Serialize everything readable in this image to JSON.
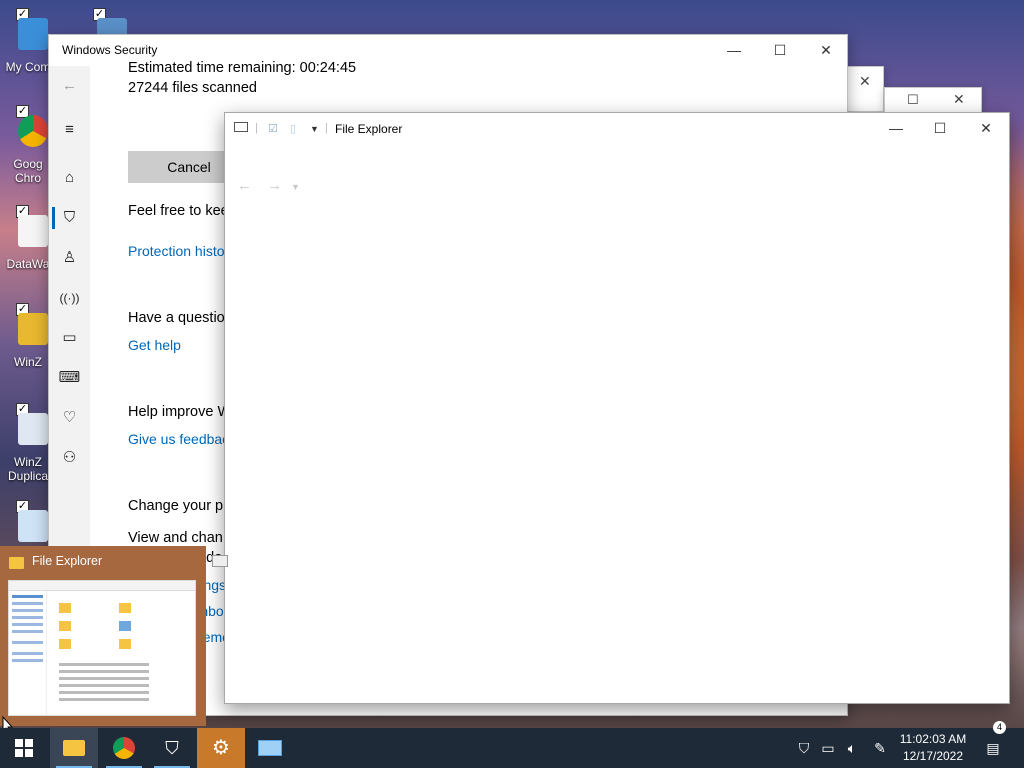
{
  "desktop": {
    "icons": [
      {
        "label": "My Com",
        "icon": "computer-icon"
      },
      {
        "label": "Goog Chro",
        "icon": "chrome-icon"
      },
      {
        "label": "DataWa",
        "icon": "document-icon"
      },
      {
        "label": "WinZ",
        "icon": "winzip-icon"
      },
      {
        "label": "WinZ Duplica",
        "icon": "winzip-duplicate-icon"
      }
    ]
  },
  "windows_security": {
    "title": "Windows Security",
    "estimated_time": "Estimated time remaining: 00:24:45",
    "files_scanned": "27244  files scanned",
    "cancel_label": "Cancel",
    "feel_free": "Feel free to kee",
    "protection_history": "Protection histo",
    "question_heading": "Have a questio",
    "get_help": "Get help",
    "help_improve": "Help improve W",
    "give_feedback": "Give us feedbac",
    "change_heading": "Change your p",
    "view_change_line1": "View and chan",
    "view_change_line2": "for your Windo",
    "privacy_settings": "Privacy settings",
    "privacy_dashboard": "Privacy dashboa",
    "privacy_statement": "Privacy Stateme",
    "sidebar_icons": [
      "back-arrow-icon",
      "menu-icon",
      "home-icon",
      "shield-icon",
      "account-icon",
      "firewall-icon",
      "app-browser-icon",
      "device-security-icon",
      "health-icon",
      "family-icon"
    ]
  },
  "file_explorer": {
    "title": "File Explorer"
  },
  "taskbar_preview": {
    "title": "File Explorer"
  },
  "taskbar": {
    "items": [
      "start-icon",
      "file-explorer-icon",
      "chrome-icon",
      "windows-security-icon",
      "settings-icon",
      "app-icon"
    ],
    "time": "11:02:03 AM",
    "date": "12/17/2022",
    "notification_count": "4"
  },
  "colors": {
    "accent": "#0067b8",
    "taskbar": "#1f2a38",
    "preview": "#a6683e"
  }
}
